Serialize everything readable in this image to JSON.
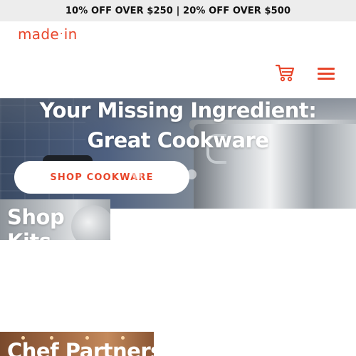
{
  "promo_banner": {
    "text": "10% OFF OVER $250 | 20% OFF OVER $500"
  },
  "header": {
    "logo": {
      "left": "made",
      "right": "in"
    },
    "cart_icon": "cart-icon",
    "menu_icon": "hamburger-menu-icon"
  },
  "hero": {
    "title_line1": "Your Missing Ingredient:",
    "title_line2": "Great Cookware",
    "cta_label": "SHOP COOKWARE",
    "carousel_dots": 3,
    "active_dot": 1
  },
  "sections": [
    {
      "title": "Shop Kits"
    },
    {
      "title": "Chef Partners"
    }
  ],
  "colors": {
    "brand": "#e8462b",
    "promo_bg": "#ededed"
  }
}
